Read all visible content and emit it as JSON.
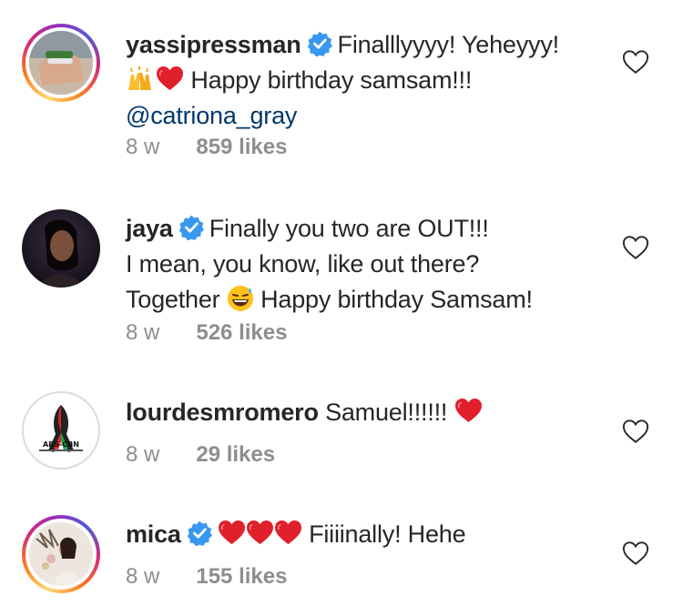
{
  "comments": [
    {
      "username": "yassipressman",
      "verified": true,
      "text_part1": "Finalllyyyy! Yeheyyy!",
      "text_part2": "Happy birthday samsam!!!",
      "mention": "@catriona_gray",
      "time": "8 w",
      "likes": "859 likes",
      "icons": [
        "verified-badge-icon",
        "raised-hands-emoji",
        "red-heart-emoji",
        "heart-outline-icon"
      ]
    },
    {
      "username": "jaya",
      "verified": true,
      "line1": "Finally you two are OUT!!!",
      "line2": "I mean, you know, like out there?",
      "line3_a": "Together",
      "line3_b": "Happy birthday Samsam!",
      "time": "8 w",
      "likes": "526 likes",
      "icons": [
        "verified-badge-icon",
        "grinning-sweat-emoji",
        "heart-outline-icon"
      ]
    },
    {
      "username": "lourdesmromero",
      "verified": false,
      "text": "Samuel!!!!!!",
      "avatar_logo_text": "ABS-CBN",
      "time": "8 w",
      "likes": "29 likes",
      "icons": [
        "red-heart-emoji",
        "heart-outline-icon"
      ]
    },
    {
      "username": "mica",
      "verified": true,
      "text": "Fiiiinally! Hehe",
      "time": "8 w",
      "likes": "155 likes",
      "icons": [
        "verified-badge-icon",
        "red-heart-emoji",
        "heart-outline-icon"
      ]
    }
  ],
  "colors": {
    "text": "#262626",
    "muted": "#8e8e8e",
    "verified": "#3897f0",
    "heart": "#ed1c24",
    "mention": "#00376b"
  }
}
